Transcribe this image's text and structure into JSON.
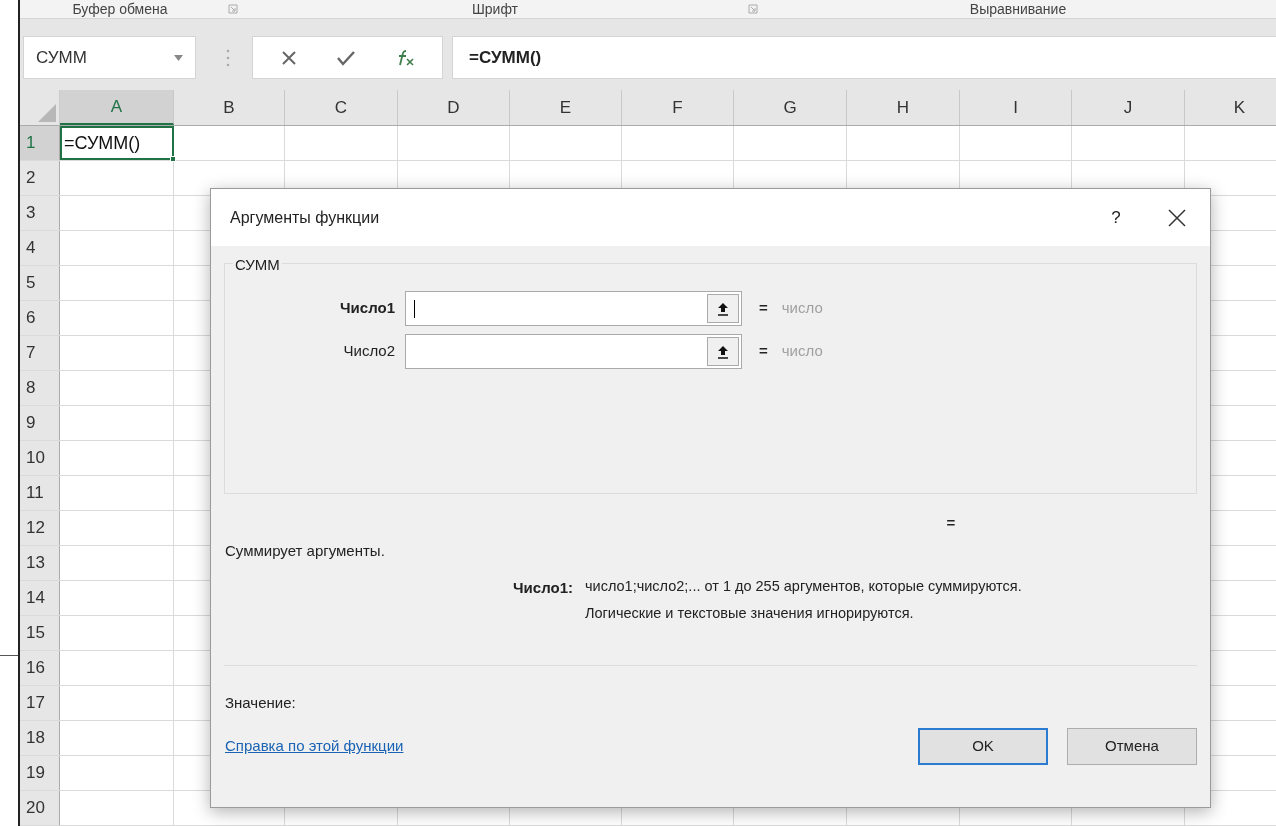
{
  "ribbon_groups": [
    {
      "label": "Буфер обмена",
      "launcher": true
    },
    {
      "label": "Шрифт",
      "launcher": true
    },
    {
      "label": "Выравнивание",
      "launcher": false
    }
  ],
  "name_box": {
    "value": "СУММ"
  },
  "formula_bar": {
    "value": "=СУММ()"
  },
  "columns": [
    {
      "label": "A",
      "selected": true
    },
    {
      "label": "B",
      "selected": false
    },
    {
      "label": "C",
      "selected": false
    },
    {
      "label": "D",
      "selected": false
    },
    {
      "label": "E",
      "selected": false
    },
    {
      "label": "F",
      "selected": false
    },
    {
      "label": "G",
      "selected": false
    },
    {
      "label": "H",
      "selected": false
    },
    {
      "label": "I",
      "selected": false
    },
    {
      "label": "J",
      "selected": false
    },
    {
      "label": "K",
      "selected": false
    }
  ],
  "rows": [
    {
      "label": "1",
      "selected": true,
      "value": "=СУММ()"
    },
    {
      "label": "2",
      "selected": false
    },
    {
      "label": "3",
      "selected": false
    },
    {
      "label": "4",
      "selected": false
    },
    {
      "label": "5",
      "selected": false
    },
    {
      "label": "6",
      "selected": false
    },
    {
      "label": "7",
      "selected": false
    },
    {
      "label": "8",
      "selected": false
    },
    {
      "label": "9",
      "selected": false
    },
    {
      "label": "10",
      "selected": false
    },
    {
      "label": "11",
      "selected": false
    },
    {
      "label": "12",
      "selected": false
    },
    {
      "label": "13",
      "selected": false
    },
    {
      "label": "14",
      "selected": false
    },
    {
      "label": "15",
      "selected": false
    },
    {
      "label": "16",
      "selected": false
    },
    {
      "label": "17",
      "selected": false
    },
    {
      "label": "18",
      "selected": false
    },
    {
      "label": "19",
      "selected": false
    },
    {
      "label": "20",
      "selected": false
    }
  ],
  "dialog": {
    "title": "Аргументы функции",
    "help": "?",
    "function_name": "СУММ",
    "arguments": [
      {
        "label": "Число1",
        "focused": true,
        "equals": "=",
        "result": "число"
      },
      {
        "label": "Число2",
        "focused": false,
        "equals": "=",
        "result": "число"
      }
    ],
    "result_equals": "=",
    "description": "Суммирует аргументы.",
    "arg_help_label": "Число1:",
    "arg_help_lines": [
      "число1;число2;... от 1 до 255 аргументов, которые суммируются.",
      "Логические и текстовые значения игнорируются."
    ],
    "value_label": "Значение:",
    "help_link": "Справка по этой функции",
    "buttons": [
      {
        "label": "OK",
        "default": true
      },
      {
        "label": "Отмена",
        "default": false
      }
    ]
  }
}
